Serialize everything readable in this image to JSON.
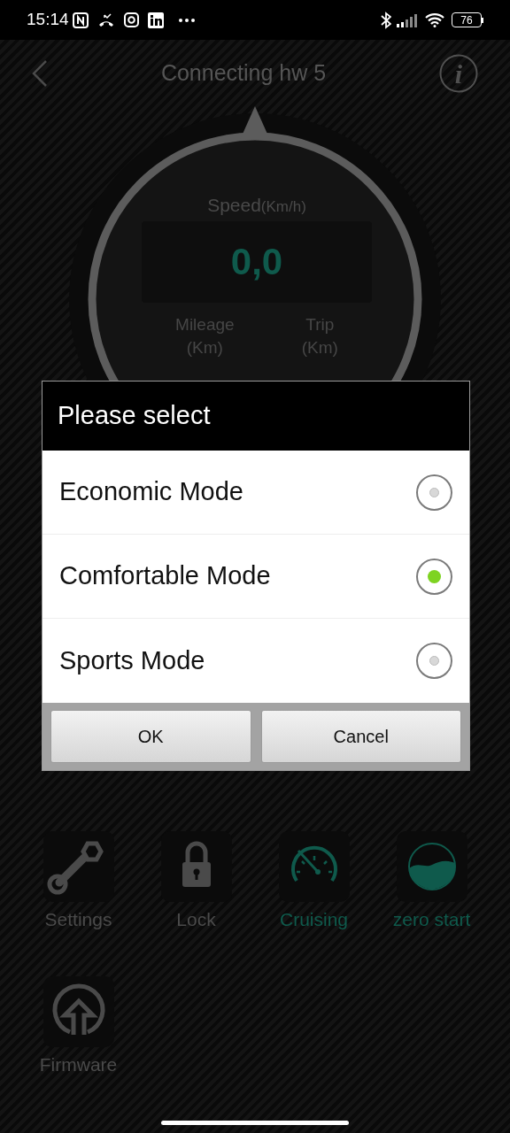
{
  "status_bar": {
    "time": "15:14",
    "battery": "76"
  },
  "header": {
    "title": "Connecting hw 5",
    "info_glyph": "i"
  },
  "gauge": {
    "label": "Speed",
    "unit": "(Km/h)",
    "value": "0,0",
    "stats": [
      {
        "label": "Mileage",
        "unit": "(Km)"
      },
      {
        "label": "Trip",
        "unit": "(Km)"
      }
    ]
  },
  "features": [
    {
      "label": "Settings",
      "kind": "wrench",
      "active": false
    },
    {
      "label": "Lock",
      "kind": "lock",
      "active": false
    },
    {
      "label": "Cruising",
      "kind": "speedometer",
      "active": true
    },
    {
      "label": "zero start",
      "kind": "fill-circle",
      "active": true
    },
    {
      "label": "Firmware",
      "kind": "upload",
      "active": false
    }
  ],
  "dialog": {
    "title": "Please select",
    "options": [
      {
        "label": "Economic Mode",
        "selected": false
      },
      {
        "label": "Comfortable Mode",
        "selected": true
      },
      {
        "label": "Sports Mode",
        "selected": false
      }
    ],
    "buttons": [
      "OK",
      "Cancel"
    ]
  }
}
